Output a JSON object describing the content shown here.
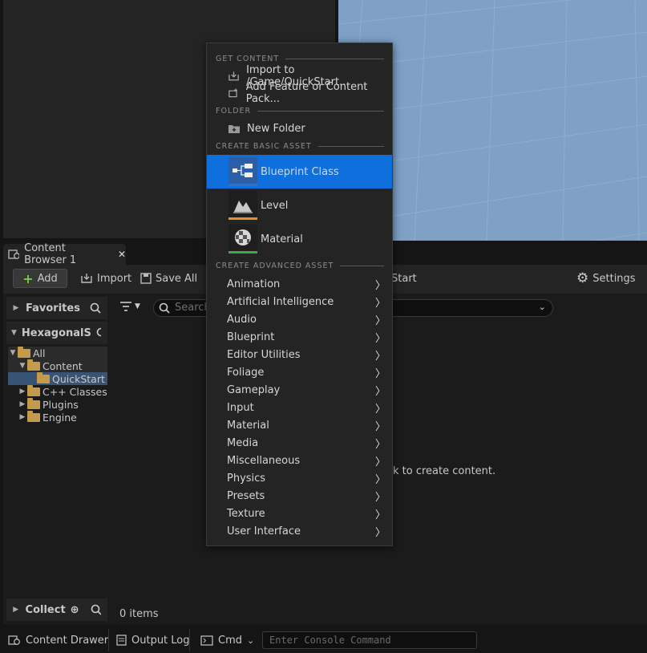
{
  "content_browser": {
    "tab_label": "Content Browser 1",
    "close_glyph": "✕",
    "toolbar": {
      "add_label": "Add",
      "import_label": "Import",
      "save_all_label": "Save All",
      "path_fragment": "Start",
      "settings_label": "Settings"
    },
    "favorites_label": "Favorites",
    "project_label": "HexagonalS",
    "collections_label": "Collect",
    "tree": {
      "all": "All",
      "content": "Content",
      "quickstart": "QuickStart",
      "cpp": "C++ Classes",
      "plugins": "Plugins",
      "engine": "Engine"
    },
    "search_placeholder": "Search",
    "empty_hint_fragment": "k to create content.",
    "item_count": "0 items"
  },
  "bottom_bar": {
    "content_drawer": "Content Drawer",
    "output_log": "Output Log",
    "cmd": "Cmd",
    "console_placeholder": "Enter Console Command"
  },
  "menu": {
    "get_content_header": "GET CONTENT",
    "import_item": "Import to /Game/QuickStart...",
    "add_feature_item": "Add Feature or Content Pack...",
    "folder_header": "FOLDER",
    "new_folder_item": "New Folder",
    "basic_header": "CREATE BASIC ASSET",
    "basic_assets": [
      {
        "label": "Blueprint Class",
        "color": "#2c72c9",
        "highlighted": true
      },
      {
        "label": "Level",
        "color": "#e3912e"
      },
      {
        "label": "Material",
        "color": "#3faa3d"
      }
    ],
    "advanced_header": "CREATE ADVANCED ASSET",
    "advanced": [
      "Animation",
      "Artificial Intelligence",
      "Audio",
      "Blueprint",
      "Editor Utilities",
      "Foliage",
      "Gameplay",
      "Input",
      "Material",
      "Media",
      "Miscellaneous",
      "Physics",
      "Presets",
      "Texture",
      "User Interface"
    ],
    "highlight_color": "#0f6fdd"
  }
}
